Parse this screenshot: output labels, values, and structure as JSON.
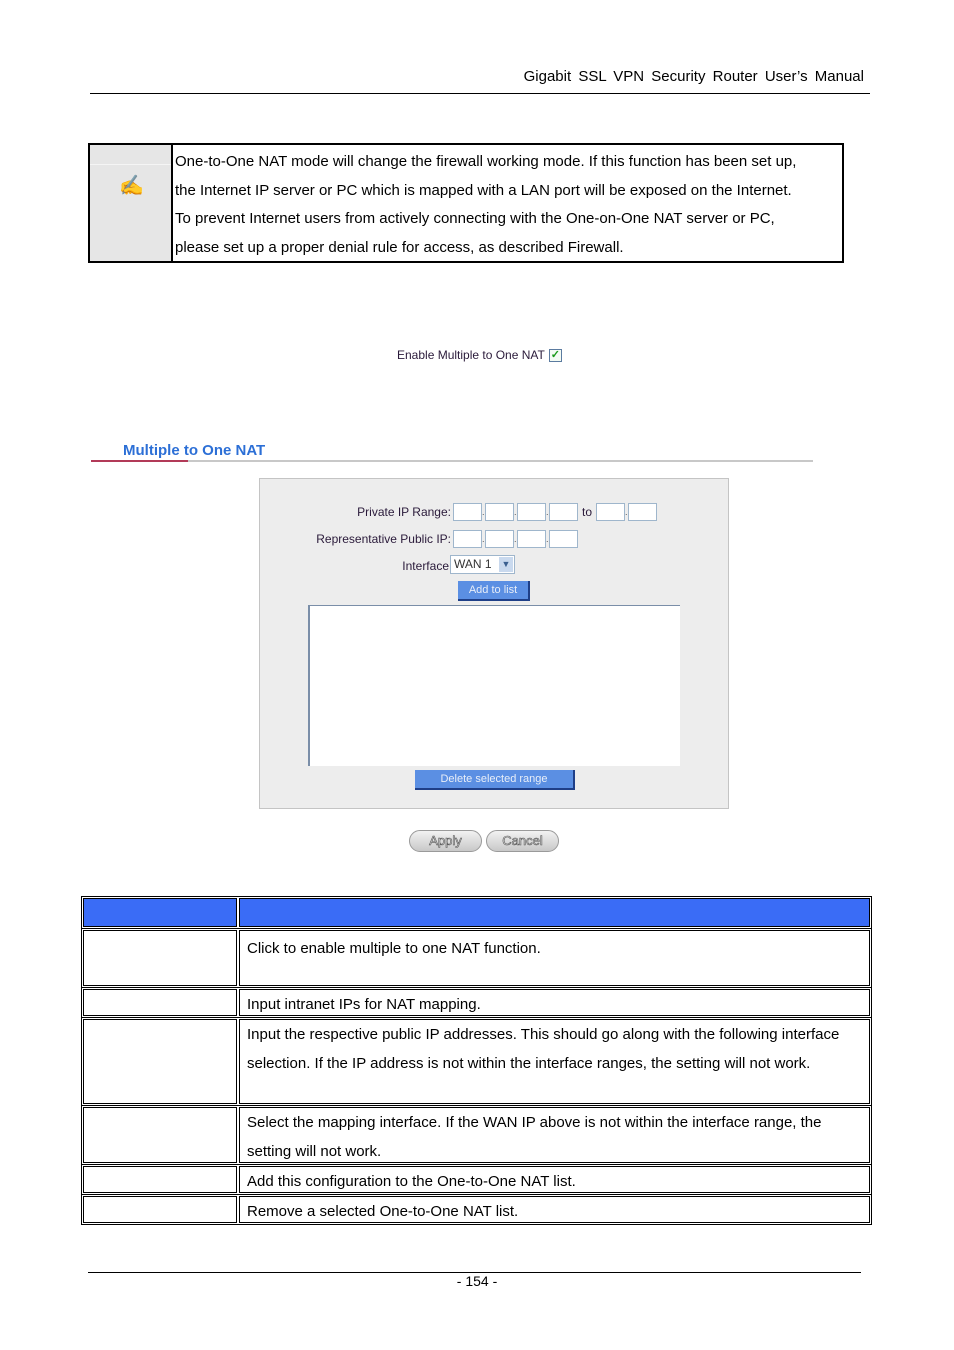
{
  "header": {
    "title": "Gigabit SSL VPN Security Router User’s Manual"
  },
  "note": {
    "icon": "writing-hand-icon",
    "lines": [
      "One-to-One NAT mode will change the firewall working mode. If this function has been set up,",
      "the Internet IP server or PC which is mapped with a LAN port will be exposed on the Internet.",
      "To prevent Internet users from actively connecting with the One-on-One NAT server or PC,",
      "please set up a proper denial rule for access, as described Firewall."
    ]
  },
  "enable": {
    "label": "Enable Multiple to One NAT",
    "checked": true
  },
  "section": {
    "title": "Multiple to One NAT"
  },
  "form": {
    "private_ip_label": "Private IP Range:",
    "to_label": "to",
    "public_ip_label": "Representative Public IP:",
    "interface_label": "Interface",
    "interface_value": "WAN 1",
    "add_button": "Add to list",
    "delete_button": "Delete selected range"
  },
  "buttons": {
    "apply": "Apply",
    "cancel": "Cancel"
  },
  "table": {
    "rows": [
      {
        "name": "",
        "desc": "Click to enable multiple to one NAT function."
      },
      {
        "name": "",
        "desc": "Input intranet IPs for NAT mapping."
      },
      {
        "name": "",
        "desc": "Input the respective public IP addresses. This should go along with the following interface selection. If the IP address is not within the interface ranges, the setting will not work."
      },
      {
        "name": "",
        "desc": "Select the mapping interface. If the WAN IP above is not within the interface range, the setting will not work."
      },
      {
        "name": "",
        "desc": "Add this configuration to the One-to-One NAT list."
      },
      {
        "name": "",
        "desc": "Remove a selected One-to-One NAT list."
      }
    ]
  },
  "footer": {
    "page": "- 154 -"
  },
  "colors": {
    "table_header": "#3a6cf6",
    "section_title": "#2c6fd6",
    "button_blue": "#5b8fe3"
  }
}
